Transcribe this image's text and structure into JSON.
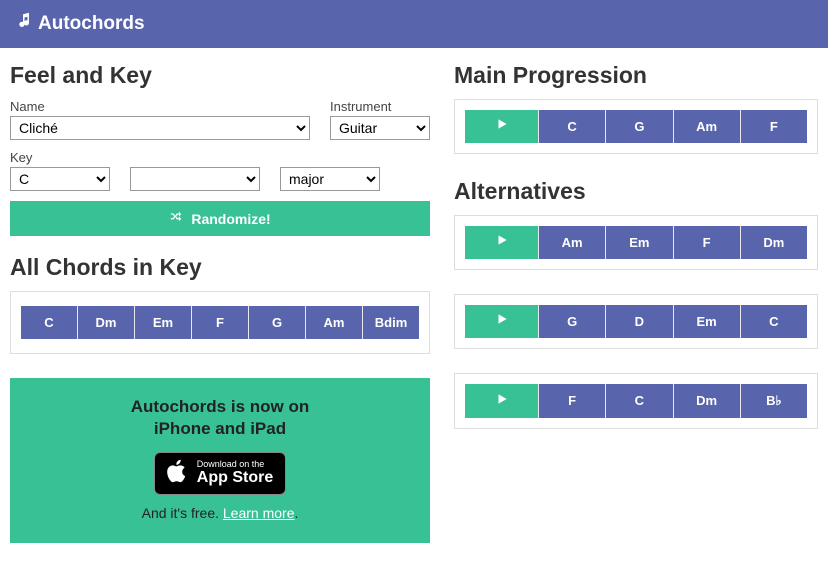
{
  "brand": "Autochords",
  "left": {
    "heading_feel": "Feel and Key",
    "label_name": "Name",
    "label_instrument": "Instrument",
    "label_key": "Key",
    "name_value": "Cliché",
    "instrument_value": "Guitar",
    "key_root": "C",
    "key_accidental": "",
    "key_mode": "major",
    "randomize_label": "Randomize!",
    "heading_allchords": "All Chords in Key",
    "all_chords": [
      "C",
      "Dm",
      "Em",
      "F",
      "G",
      "Am",
      "Bdim"
    ]
  },
  "promo": {
    "title_line1": "Autochords is now on",
    "title_line2": "iPhone and iPad",
    "badge_small": "Download on the",
    "badge_big": "App Store",
    "sub_text": "And it's free. ",
    "learn_more": "Learn more"
  },
  "right": {
    "heading_main": "Main Progression",
    "main_progression": [
      "C",
      "G",
      "Am",
      "F"
    ],
    "heading_alt": "Alternatives",
    "alternatives": [
      [
        "Am",
        "Em",
        "F",
        "Dm"
      ],
      [
        "G",
        "D",
        "Em",
        "C"
      ],
      [
        "F",
        "C",
        "Dm",
        "B♭"
      ]
    ]
  }
}
